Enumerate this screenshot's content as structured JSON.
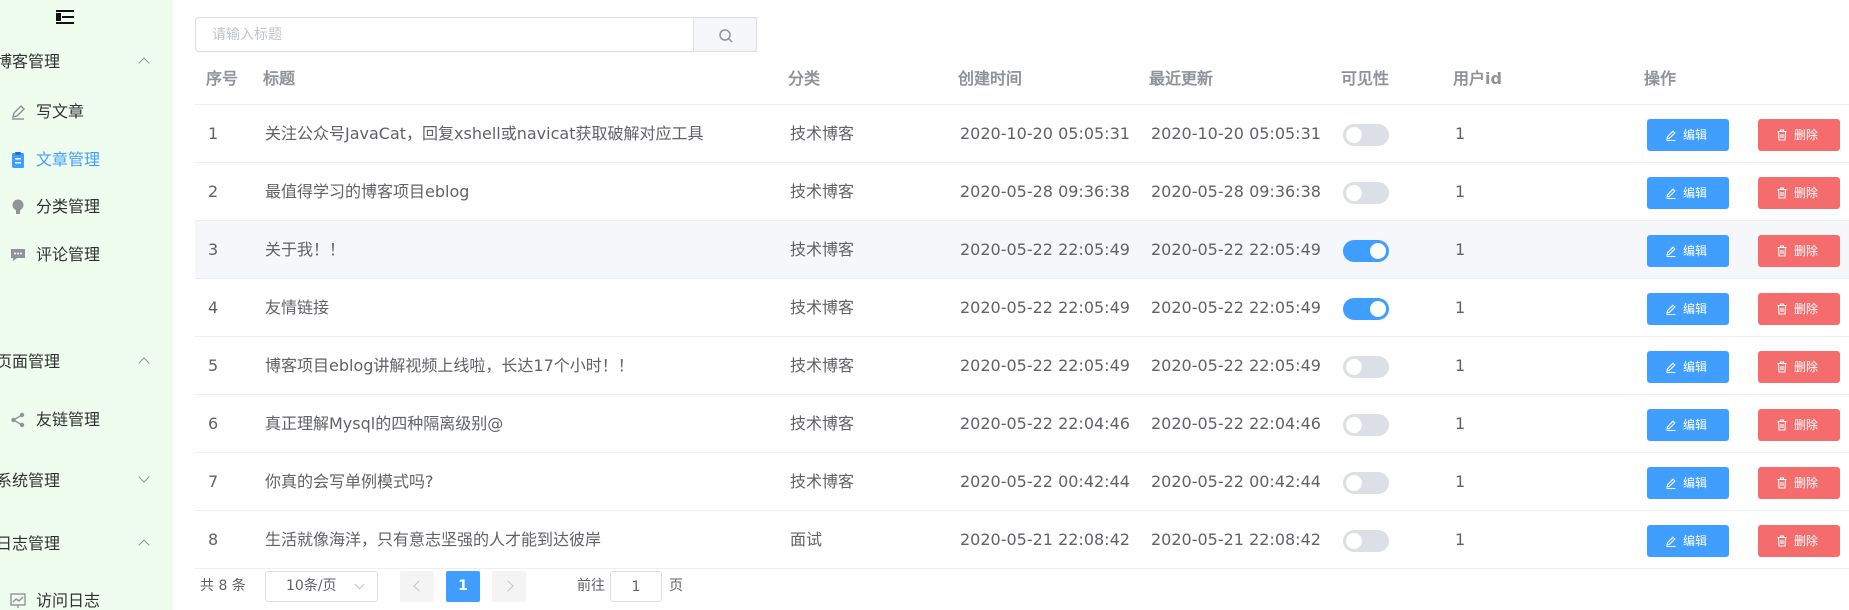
{
  "sidebar": {
    "groups": [
      {
        "label": "博客管理",
        "expanded": true,
        "items": [
          {
            "label": "写文章",
            "icon": "pen-icon",
            "active": false
          },
          {
            "label": "文章管理",
            "icon": "clipboard-icon",
            "active": true
          },
          {
            "label": "分类管理",
            "icon": "bulb-icon",
            "active": false
          },
          {
            "label": "评论管理",
            "icon": "chat-icon",
            "active": false
          }
        ]
      },
      {
        "label": "页面管理",
        "expanded": true,
        "items": [
          {
            "label": "友链管理",
            "icon": "share-icon",
            "active": false
          }
        ]
      },
      {
        "label": "系统管理",
        "expanded": false,
        "items": []
      },
      {
        "label": "日志管理",
        "expanded": true,
        "items": [
          {
            "label": "访问日志",
            "icon": "chart-icon",
            "active": false
          }
        ]
      }
    ]
  },
  "search": {
    "placeholder": "请输入标题",
    "value": ""
  },
  "table": {
    "columns": [
      "序号",
      "标题",
      "分类",
      "创建时间",
      "最近更新",
      "可见性",
      "用户id",
      "操作"
    ],
    "rows": [
      {
        "idx": "1",
        "title": "关注公众号JavaCat，回复xshell或navicat获取破解对应工具",
        "category": "技术博客",
        "created": "2020-10-20 05:05:31",
        "updated": "2020-10-20 05:05:31",
        "visible": false,
        "uid": "1"
      },
      {
        "idx": "2",
        "title": "最值得学习的博客项目eblog",
        "category": "技术博客",
        "created": "2020-05-28 09:36:38",
        "updated": "2020-05-28 09:36:38",
        "visible": false,
        "uid": "1"
      },
      {
        "idx": "3",
        "title": "关于我！！",
        "category": "技术博客",
        "created": "2020-05-22 22:05:49",
        "updated": "2020-05-22 22:05:49",
        "visible": true,
        "uid": "1"
      },
      {
        "idx": "4",
        "title": "友情链接",
        "category": "技术博客",
        "created": "2020-05-22 22:05:49",
        "updated": "2020-05-22 22:05:49",
        "visible": true,
        "uid": "1"
      },
      {
        "idx": "5",
        "title": "博客项目eblog讲解视频上线啦，长达17个小时！！",
        "category": "技术博客",
        "created": "2020-05-22 22:05:49",
        "updated": "2020-05-22 22:05:49",
        "visible": false,
        "uid": "1"
      },
      {
        "idx": "6",
        "title": "真正理解Mysql的四种隔离级别@",
        "category": "技术博客",
        "created": "2020-05-22 22:04:46",
        "updated": "2020-05-22 22:04:46",
        "visible": false,
        "uid": "1"
      },
      {
        "idx": "7",
        "title": "你真的会写单例模式吗?",
        "category": "技术博客",
        "created": "2020-05-22 00:42:44",
        "updated": "2020-05-22 00:42:44",
        "visible": false,
        "uid": "1"
      },
      {
        "idx": "8",
        "title": "生活就像海洋，只有意志坚强的人才能到达彼岸",
        "category": "面试",
        "created": "2020-05-21 22:08:42",
        "updated": "2020-05-21 22:08:42",
        "visible": false,
        "uid": "1"
      }
    ],
    "edit_label": "编辑",
    "delete_label": "删除",
    "highlight_row": 3
  },
  "pagination": {
    "total_text": "共 8 条",
    "page_size": "10条/页",
    "current_page": "1",
    "goto_prefix": "前往",
    "goto_value": "1",
    "goto_suffix": "页"
  },
  "colors": {
    "primary": "#409eff",
    "danger": "#f56c6c",
    "sidebar_bg": "#effdef"
  }
}
